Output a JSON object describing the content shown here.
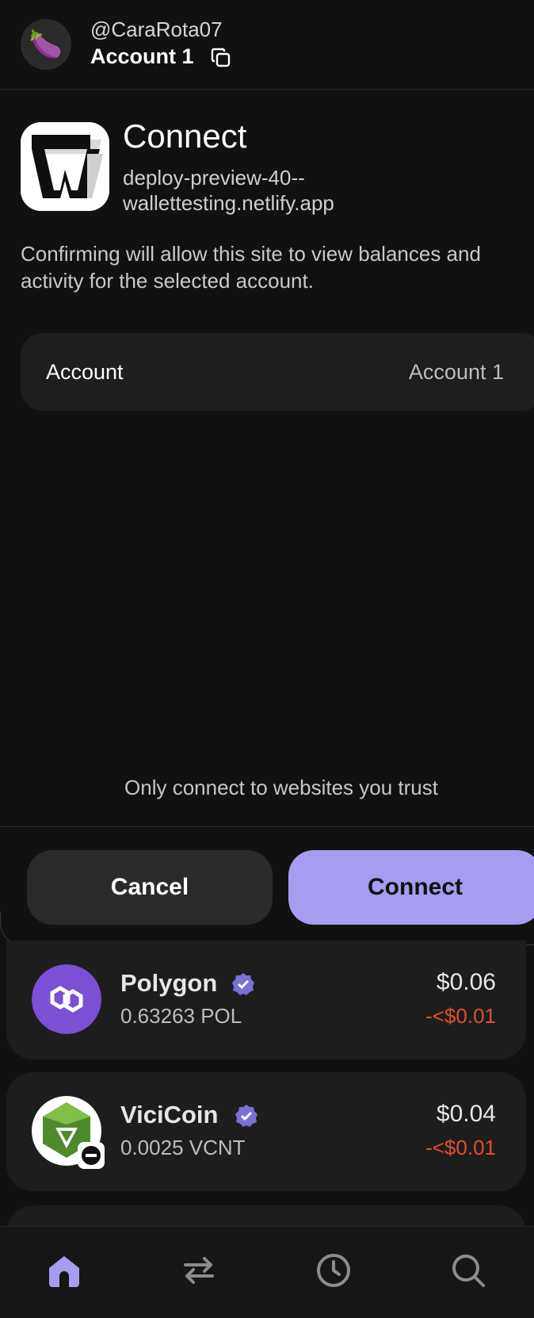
{
  "header": {
    "avatar_emoji": "🍆",
    "handle": "@CaraRota07",
    "account_name": "Account 1"
  },
  "connect": {
    "title": "Connect",
    "site_url": "deploy-preview-40--wallettesting.netlify.app",
    "description": "Confirming will allow this site to view balances and activity for the selected account.",
    "account_label": "Account",
    "account_value": "Account 1",
    "trust_notice": "Only connect to websites you trust",
    "cancel_label": "Cancel",
    "connect_label": "Connect"
  },
  "tokens": [
    {
      "name": "Polygon",
      "amount": "0.63263 POL",
      "usd": "$0.06",
      "change": "-<$0.01"
    },
    {
      "name": "ViciCoin",
      "amount": "0.0025 VCNT",
      "usd": "$0.04",
      "change": "-<$0.01"
    }
  ],
  "nav": [
    "home-icon",
    "swap-icon",
    "history-icon",
    "search-icon"
  ],
  "colors": {
    "accent": "#a69cf0",
    "negative": "#e0502c",
    "background": "#111111",
    "card": "#1d1d1d"
  }
}
